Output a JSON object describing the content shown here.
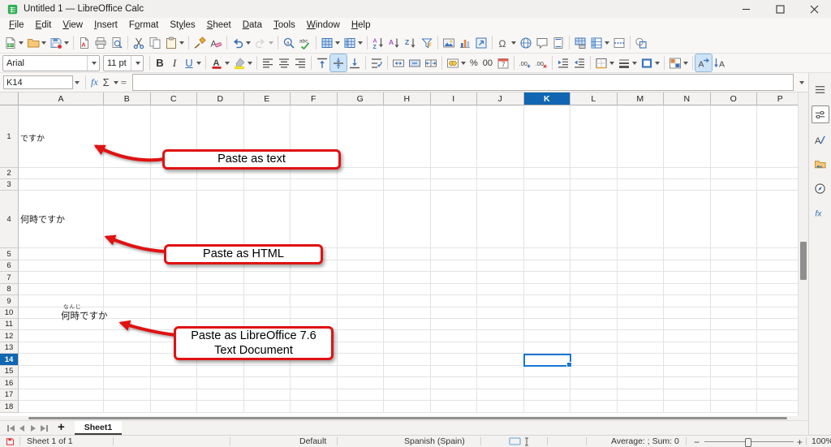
{
  "window": {
    "title": "Untitled 1 — LibreOffice Calc",
    "controls": [
      "minimize",
      "maximize",
      "close"
    ]
  },
  "menubar": {
    "items": [
      {
        "label": "File",
        "accel": 0
      },
      {
        "label": "Edit",
        "accel": 0
      },
      {
        "label": "View",
        "accel": 0
      },
      {
        "label": "Insert",
        "accel": 0
      },
      {
        "label": "Format",
        "accel": 1
      },
      {
        "label": "Styles",
        "accel": 2
      },
      {
        "label": "Sheet",
        "accel": 0
      },
      {
        "label": "Data",
        "accel": 0
      },
      {
        "label": "Tools",
        "accel": 0
      },
      {
        "label": "Window",
        "accel": 0
      },
      {
        "label": "Help",
        "accel": 0
      }
    ]
  },
  "toolbar_standard": {
    "items": [
      {
        "name": "new",
        "glyph": "doc-new",
        "dropdown": true
      },
      {
        "name": "open",
        "glyph": "folder",
        "dropdown": true
      },
      {
        "name": "save",
        "glyph": "save",
        "dropdown": true
      },
      {
        "sep": true
      },
      {
        "name": "export-pdf",
        "glyph": "pdf"
      },
      {
        "name": "print",
        "glyph": "printer"
      },
      {
        "name": "print-preview",
        "glyph": "preview"
      },
      {
        "sep": true
      },
      {
        "name": "cut",
        "glyph": "cut"
      },
      {
        "name": "copy",
        "glyph": "copy"
      },
      {
        "name": "paste",
        "glyph": "paste",
        "dropdown": true
      },
      {
        "sep": true
      },
      {
        "name": "clone-formatting",
        "glyph": "brush"
      },
      {
        "name": "clear-formatting",
        "glyph": "clear"
      },
      {
        "sep": true
      },
      {
        "name": "undo",
        "glyph": "undo",
        "dropdown": true
      },
      {
        "name": "redo",
        "glyph": "redo",
        "dropdown": true,
        "disabled": true
      },
      {
        "sep": true
      },
      {
        "name": "find-replace",
        "glyph": "find"
      },
      {
        "name": "spelling",
        "glyph": "spell"
      },
      {
        "sep": true
      },
      {
        "name": "insert-row",
        "glyph": "table",
        "dropdown": true
      },
      {
        "name": "insert-column",
        "glyph": "table2",
        "dropdown": true
      },
      {
        "sep": true
      },
      {
        "name": "sort",
        "glyph": "sort"
      },
      {
        "name": "sort-ascending",
        "glyph": "sort-asc"
      },
      {
        "name": "sort-descending",
        "glyph": "sort-desc"
      },
      {
        "name": "autofilter",
        "glyph": "filter"
      },
      {
        "sep": true
      },
      {
        "name": "insert-image",
        "glyph": "image"
      },
      {
        "name": "insert-chart",
        "glyph": "chart"
      },
      {
        "name": "insert-pivot-table",
        "glyph": "pivot"
      },
      {
        "sep": true
      },
      {
        "name": "special-character",
        "glyph": "omega",
        "dropdown": true
      },
      {
        "name": "insert-hyperlink",
        "glyph": "link"
      },
      {
        "name": "insert-comment",
        "glyph": "comment"
      },
      {
        "name": "headers-footers",
        "glyph": "headfoot"
      },
      {
        "sep": true
      },
      {
        "name": "print-area",
        "glyph": "printarea"
      },
      {
        "name": "freeze-rows-columns",
        "glyph": "freeze",
        "dropdown": true
      },
      {
        "name": "split-window",
        "glyph": "split"
      },
      {
        "sep": true
      },
      {
        "name": "show-draw-functions",
        "glyph": "shapes"
      }
    ]
  },
  "toolbar_formatting": {
    "font_name": "Arial",
    "font_size": "11 pt",
    "items": [
      {
        "name": "bold",
        "text": "B",
        "tcls": "b"
      },
      {
        "name": "italic",
        "text": "I",
        "tcls": "i"
      },
      {
        "name": "underline",
        "text": "U",
        "tcls": "u",
        "dropdown": true
      },
      {
        "sep": true
      },
      {
        "name": "font-color",
        "glyph": "fontcolor",
        "dropdown": true
      },
      {
        "name": "highlighting-color",
        "glyph": "highlight",
        "dropdown": true
      },
      {
        "sep": true
      },
      {
        "name": "align-left",
        "glyph": "alignL"
      },
      {
        "name": "align-center",
        "glyph": "alignC"
      },
      {
        "name": "align-right",
        "glyph": "alignR"
      },
      {
        "sep": true
      },
      {
        "name": "align-top",
        "glyph": "vtop"
      },
      {
        "name": "center-vertically",
        "glyph": "vcenter",
        "active": true
      },
      {
        "name": "align-bottom",
        "glyph": "vbottom"
      },
      {
        "sep": true
      },
      {
        "name": "wrap-text",
        "glyph": "wrap"
      },
      {
        "sep": true
      },
      {
        "name": "merge-and-center",
        "glyph": "mergec"
      },
      {
        "name": "merge-cells",
        "glyph": "merge"
      },
      {
        "name": "unmerge-cells",
        "glyph": "unmerge"
      },
      {
        "sep": true
      },
      {
        "name": "format-currency",
        "glyph": "currency",
        "dropdown": true
      },
      {
        "name": "format-percent",
        "text": "%",
        "tcls": "sm"
      },
      {
        "name": "format-number",
        "text": "00",
        "tcls": "sm"
      },
      {
        "name": "format-date",
        "glyph": "date"
      },
      {
        "sep": true
      },
      {
        "name": "add-decimal-place",
        "glyph": "decadd"
      },
      {
        "name": "delete-decimal-place",
        "glyph": "decdel"
      },
      {
        "sep": true
      },
      {
        "name": "increase-indent",
        "glyph": "indentp"
      },
      {
        "name": "decrease-indent",
        "glyph": "indentm"
      },
      {
        "sep": true
      },
      {
        "name": "borders",
        "glyph": "borders",
        "dropdown": true
      },
      {
        "name": "border-style",
        "glyph": "bstyle",
        "dropdown": true
      },
      {
        "name": "border-color",
        "glyph": "bcolor",
        "dropdown": true
      },
      {
        "sep": true
      },
      {
        "name": "conditional-formatting",
        "glyph": "condfmt",
        "dropdown": true
      },
      {
        "sep": true
      },
      {
        "name": "text-direction-left-to-right",
        "glyph": "ltr",
        "active": true
      },
      {
        "name": "text-direction-top-to-bottom",
        "glyph": "ttb"
      }
    ]
  },
  "formula_bar": {
    "cell_reference": "K14",
    "function_wizard": "fx",
    "sum": "Σ",
    "equals": "=",
    "formula_value": ""
  },
  "grid": {
    "columns": [
      "A",
      "B",
      "C",
      "D",
      "E",
      "F",
      "G",
      "H",
      "I",
      "J",
      "K",
      "L",
      "M",
      "N",
      "O",
      "P"
    ],
    "selected_column": "K",
    "row_count": 18,
    "selected_row": 14,
    "selected_cell": "K14",
    "cells": [
      {
        "ref": "A1",
        "text": "ですか"
      },
      {
        "ref": "A4",
        "text": "何時ですか"
      },
      {
        "ref": "A10",
        "text": "何時ですか",
        "ruby": "なんじ"
      }
    ]
  },
  "annotations": [
    {
      "label": "Paste as text"
    },
    {
      "label": "Paste as HTML"
    },
    {
      "label": "Paste as LibreOffice 7.6 Text Document"
    }
  ],
  "sidebar": {
    "items": [
      {
        "name": "sidebar-settings",
        "glyph": "menu"
      },
      {
        "name": "properties",
        "glyph": "sliders",
        "boxed": true
      },
      {
        "name": "styles",
        "glyph": "styles"
      },
      {
        "name": "gallery",
        "glyph": "gallery"
      },
      {
        "name": "navigator",
        "glyph": "navigator"
      },
      {
        "name": "functions",
        "glyph": "fx"
      }
    ]
  },
  "sheet_bar": {
    "nav": [
      "first-sheet",
      "previous-sheet",
      "next-sheet",
      "last-sheet"
    ],
    "add_label": "+",
    "tabs": [
      "Sheet1"
    ],
    "active_tab": "Sheet1"
  },
  "status_bar": {
    "sheet_info": "Sheet 1 of 1",
    "page_style": "Default",
    "language": "Spanish (Spain)",
    "stats": "Average: ; Sum: 0",
    "zoom": "100%"
  },
  "colors": {
    "annotation_red": "#e01212",
    "selection_blue": "#1877d2",
    "selected_header_blue": "#1066b0"
  }
}
